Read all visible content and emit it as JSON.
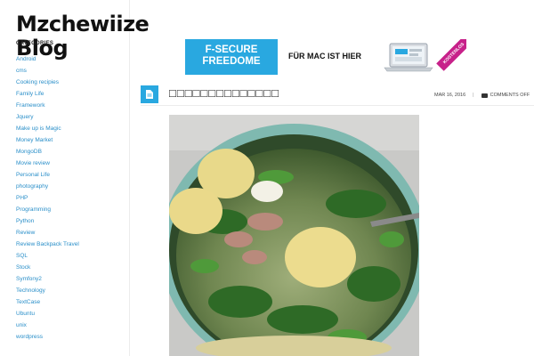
{
  "site": {
    "title": "Mzchewiize Blog"
  },
  "sidebar": {
    "heading": "CATEGORIES",
    "categories": [
      "Android",
      "cms",
      "Cooking recipies",
      "Family Life",
      "Framework",
      "Jquery",
      "Make up is Magic",
      "Money Market",
      "MongoDB",
      "Movie review",
      "Personal Life",
      "photography",
      "PHP",
      "Programming",
      "Python",
      "Review",
      "Review Backpack Travel",
      "SQL",
      "Stock",
      "Symfony2",
      "Technology",
      "TextCase",
      "Ubuntu",
      "unix",
      "wordpress"
    ]
  },
  "ad": {
    "brand_line1": "F-SECURE",
    "brand_line2": "FREEDOME",
    "tagline": "FÜR MAC IST HIER",
    "ribbon": "KOSTENLOS TESTEN",
    "brand_color": "#29a8e0",
    "ribbon_color": "#c7218a"
  },
  "post": {
    "title": "□□□□□□□□□□□□□□",
    "date": "MAR 16, 2016",
    "separator": "|",
    "comments": "COMMENTS OFF",
    "icon": "document-icon",
    "accent_color": "#29a8e0"
  }
}
